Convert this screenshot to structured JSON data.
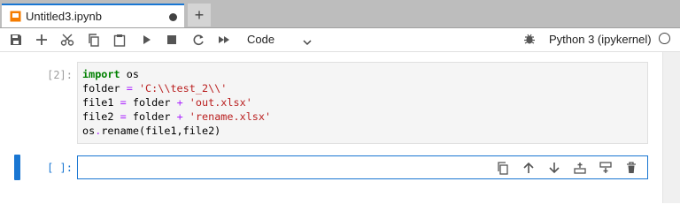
{
  "tab": {
    "title": "Untitled3.ipynb",
    "new_tab_label": "+"
  },
  "toolbar": {
    "buttons": [
      "save-icon",
      "add-icon",
      "cut-icon",
      "copy-icon",
      "paste-icon",
      "run-icon",
      "stop-icon",
      "restart-icon",
      "fast-forward-icon"
    ],
    "cell_type": "Code",
    "kernel_name": "Python 3 (ipykernel)"
  },
  "cells": [
    {
      "prompt": "[2]:",
      "lines": [
        [
          {
            "t": "import",
            "c": "kw"
          },
          {
            "t": " os",
            "c": ""
          }
        ],
        [
          {
            "t": "folder ",
            "c": ""
          },
          {
            "t": "=",
            "c": "op"
          },
          {
            "t": " ",
            "c": ""
          },
          {
            "t": "'C:\\\\test_2\\\\'",
            "c": "str"
          }
        ],
        [
          {
            "t": "file1 ",
            "c": ""
          },
          {
            "t": "=",
            "c": "op"
          },
          {
            "t": " folder ",
            "c": ""
          },
          {
            "t": "+",
            "c": "op"
          },
          {
            "t": " ",
            "c": ""
          },
          {
            "t": "'out.xlsx'",
            "c": "str"
          }
        ],
        [
          {
            "t": "file2 ",
            "c": ""
          },
          {
            "t": "=",
            "c": "op"
          },
          {
            "t": " folder ",
            "c": ""
          },
          {
            "t": "+",
            "c": "op"
          },
          {
            "t": " ",
            "c": ""
          },
          {
            "t": "'rename.xlsx'",
            "c": "str"
          }
        ],
        [
          {
            "t": "os",
            "c": ""
          },
          {
            "t": ".",
            "c": "op"
          },
          {
            "t": "rename(file1,file2)",
            "c": ""
          }
        ]
      ]
    },
    {
      "prompt": "[ ]:",
      "lines": []
    }
  ],
  "cell_toolbar": [
    "duplicate-icon",
    "move-up-icon",
    "move-down-icon",
    "insert-above-icon",
    "insert-below-icon",
    "delete-icon"
  ],
  "colors": {
    "accent": "#1976d2",
    "string": "#ba2121",
    "keyword": "#008000",
    "operator": "#aa22ff"
  }
}
